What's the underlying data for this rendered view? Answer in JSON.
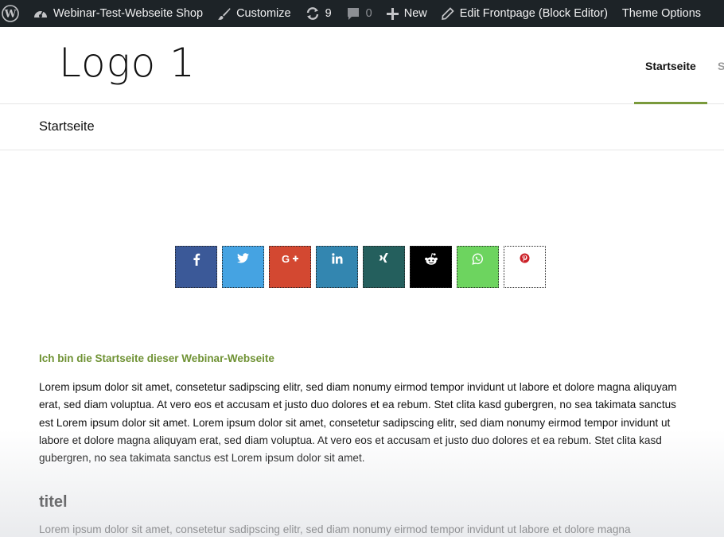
{
  "adminbar": {
    "site_name": "Webinar-Test-Webseite Shop",
    "customize": "Customize",
    "updates_count": "9",
    "comments_count": "0",
    "new_label": "New",
    "edit_label": "Edit Frontpage (Block Editor)",
    "theme_options": "Theme Options"
  },
  "header": {
    "logo": "Logo 1",
    "nav_active": "Startseite",
    "nav_next": "S"
  },
  "page": {
    "title": "Startseite"
  },
  "share": {
    "buttons": [
      {
        "icon": "facebook-icon",
        "color": "#3b5998"
      },
      {
        "icon": "twitter-icon",
        "color": "#45a3e2"
      },
      {
        "icon": "google-plus-icon",
        "color": "#d34831"
      },
      {
        "icon": "linkedin-icon",
        "color": "#3386b0"
      },
      {
        "icon": "xing-icon",
        "color": "#245f5d"
      },
      {
        "icon": "reddit-icon",
        "color": "#000000"
      },
      {
        "icon": "whatsapp-icon",
        "color": "#6dd45f"
      },
      {
        "icon": "pinterest-icon",
        "color": "#ffffff"
      }
    ]
  },
  "content": {
    "intro_heading": "Ich bin die Startseite dieser Webinar-Webseite",
    "paragraph1": "Lorem ipsum dolor sit amet, consetetur sadipscing elitr, sed diam nonumy eirmod tempor invidunt ut labore et dolore magna aliquyam erat, sed diam voluptua. At vero eos et accusam et justo duo dolores et ea rebum. Stet clita kasd gubergren, no sea takimata sanctus est Lorem ipsum dolor sit amet. Lorem ipsum dolor sit amet, consetetur sadipscing elitr, sed diam nonumy eirmod tempor invidunt ut labore et dolore magna aliquyam erat, sed diam voluptua. At vero eos et accusam et justo duo dolores et ea rebum. Stet clita kasd gubergren, no sea takimata sanctus est Lorem ipsum dolor sit amet.",
    "subheading": "titel",
    "paragraph2": "Lorem ipsum dolor sit amet, consetetur sadipscing elitr, sed diam nonumy eirmod tempor invidunt ut labore et dolore magna"
  }
}
